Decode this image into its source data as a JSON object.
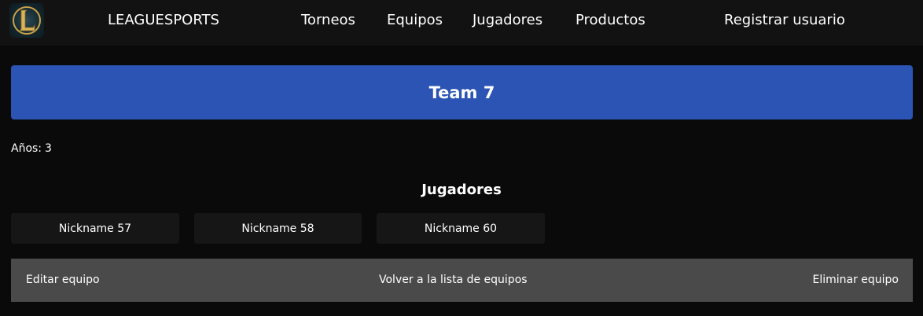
{
  "navbar": {
    "logo_icon": "league-of-legends-logo",
    "brand": "LEAGUESPORTS",
    "links": {
      "torneos": "Torneos",
      "equipos": "Equipos",
      "jugadores": "Jugadores",
      "productos": "Productos"
    },
    "register": "Registrar usuario"
  },
  "team": {
    "name": "Team 7",
    "years_label": "Años:",
    "years_value": "3"
  },
  "players": {
    "heading": "Jugadores",
    "items": [
      "Nickname 57",
      "Nickname 58",
      "Nickname 60"
    ]
  },
  "actions": {
    "edit": "Editar equipo",
    "back": "Volver a la lista de equipos",
    "delete": "Eliminar equipo"
  },
  "colors": {
    "background": "#0a0a0a",
    "navbar": "#121212",
    "banner": "#2c54b4",
    "card": "#161616",
    "actions_bar": "#4a4a4a"
  }
}
